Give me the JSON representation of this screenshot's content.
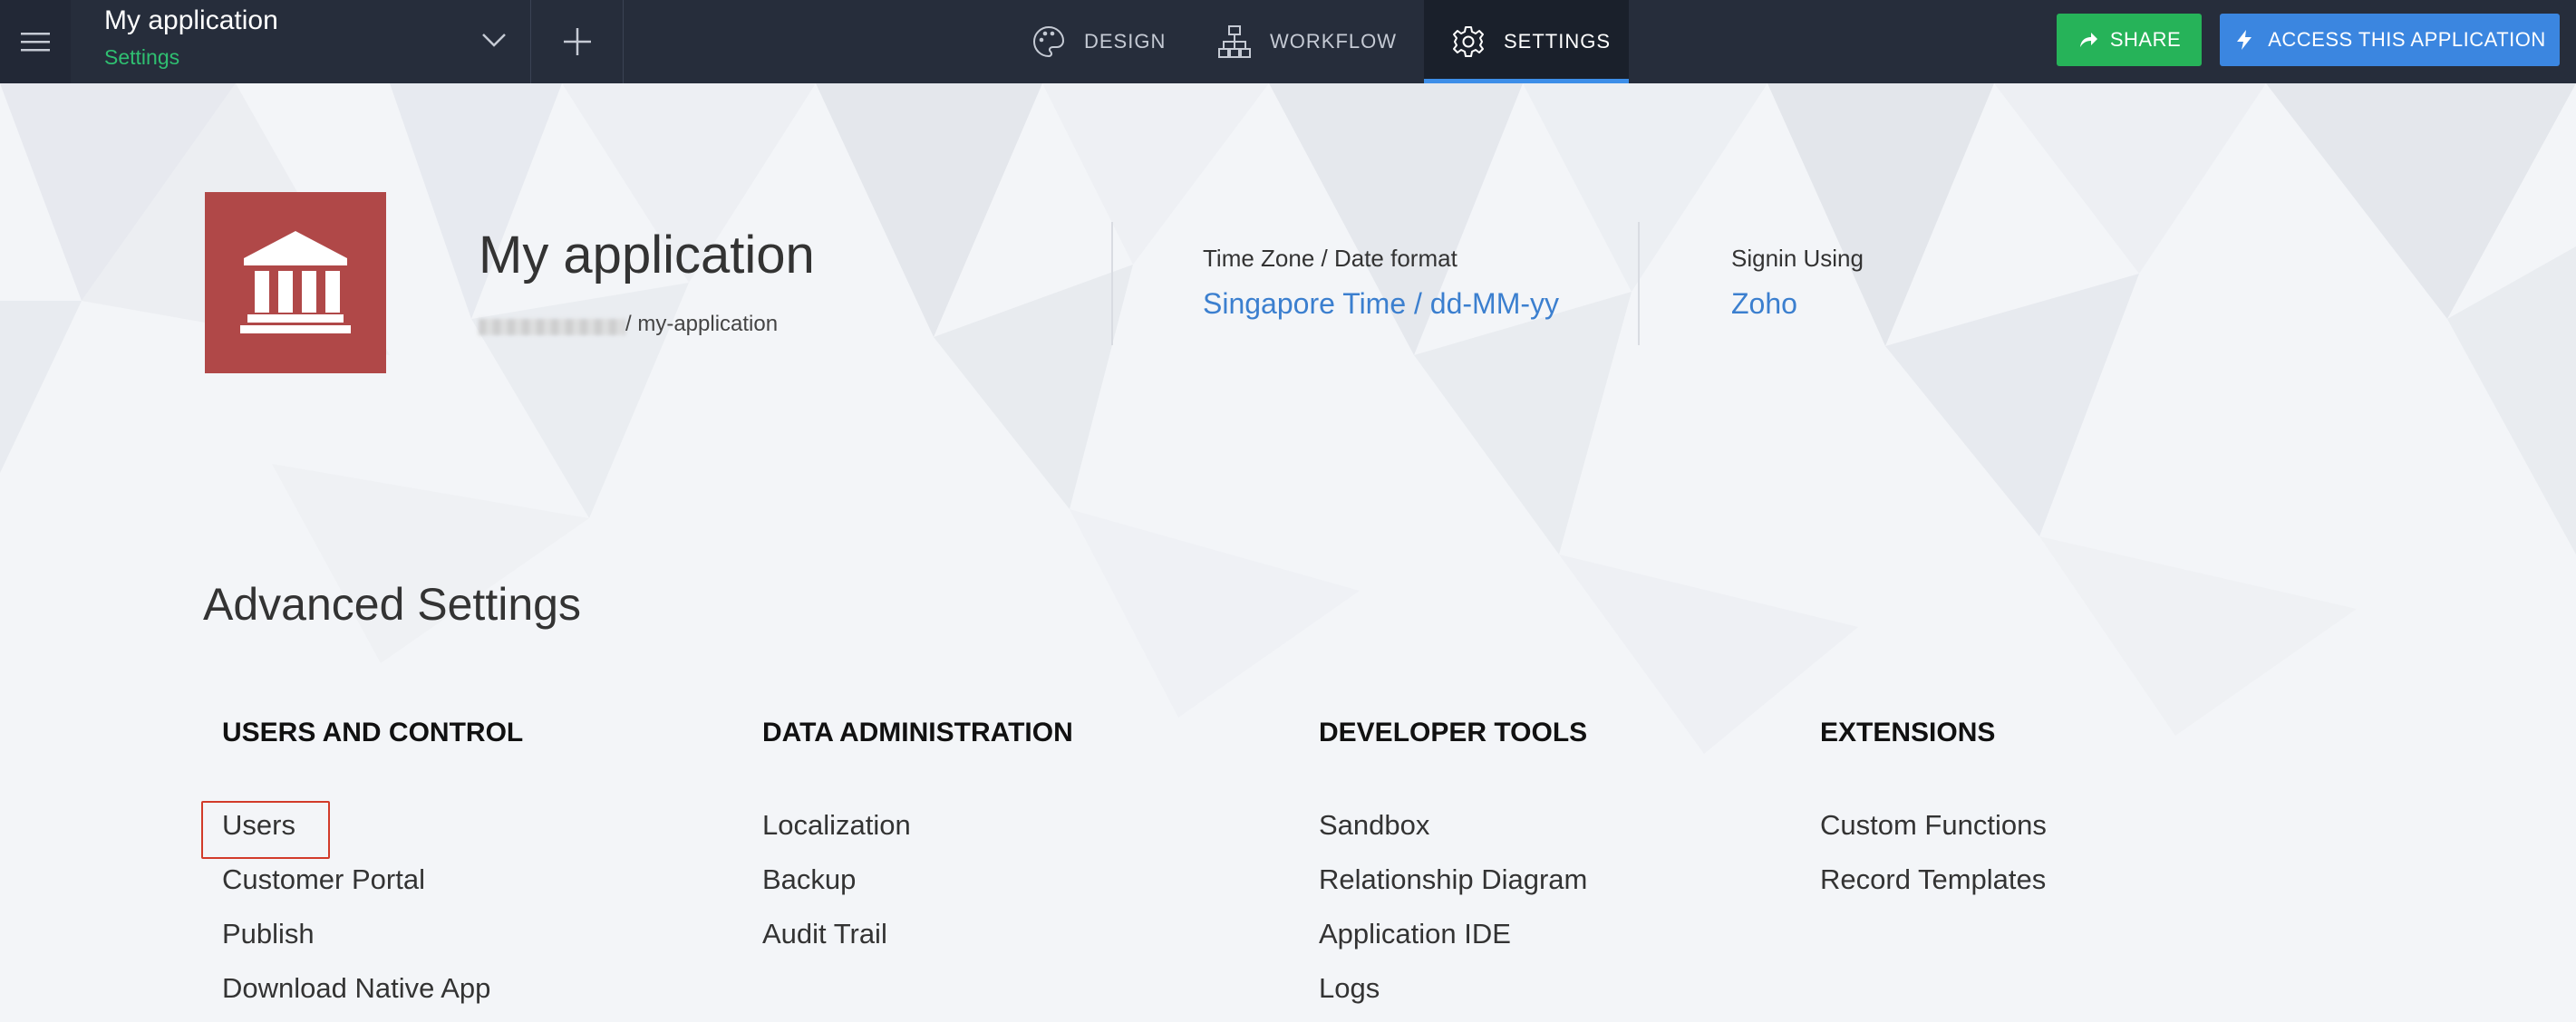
{
  "topbar": {
    "app_name": "My application",
    "app_section": "Settings",
    "tabs": [
      {
        "label": "DESIGN",
        "icon": "palette-icon"
      },
      {
        "label": "WORKFLOW",
        "icon": "workflow-icon"
      },
      {
        "label": "SETTINGS",
        "icon": "gear-icon",
        "active": true
      }
    ],
    "share_label": "SHARE",
    "access_label": "ACCESS THIS APPLICATION"
  },
  "app_info": {
    "title": "My application",
    "url_slug": "/ my-application",
    "logo_icon": "bank-icon",
    "timezone_label": "Time Zone / Date format",
    "timezone_value": "Singapore Time / dd-MM-yy",
    "signin_label": "Signin Using",
    "signin_value": "Zoho"
  },
  "advanced": {
    "title": "Advanced Settings",
    "columns": [
      {
        "heading": "USERS AND CONTROL",
        "items": [
          "Users",
          "Customer Portal",
          "Publish",
          "Download Native App"
        ]
      },
      {
        "heading": "DATA ADMINISTRATION",
        "items": [
          "Localization",
          "Backup",
          "Audit Trail"
        ]
      },
      {
        "heading": "DEVELOPER TOOLS",
        "items": [
          "Sandbox",
          "Relationship Diagram",
          "Application IDE",
          "Logs"
        ]
      },
      {
        "heading": "EXTENSIONS",
        "items": [
          "Custom Functions",
          "Record Templates"
        ]
      }
    ]
  },
  "colors": {
    "topbar": "#262d3b",
    "share": "#26b359",
    "access": "#3b86e0",
    "accent_green": "#2fbf71",
    "link_blue": "#3b7fcf",
    "logo_bg": "#b04848",
    "highlight": "#d23b2a"
  }
}
